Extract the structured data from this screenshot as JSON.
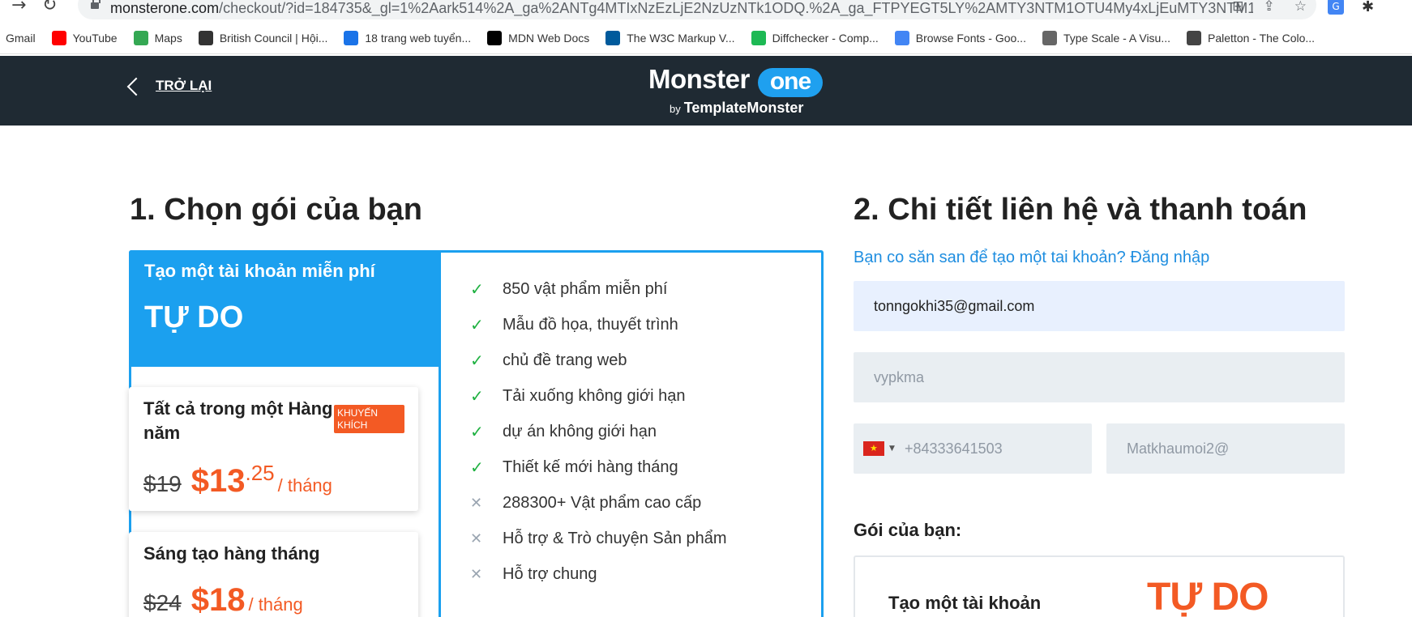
{
  "browser": {
    "url_host": "monsterone.com",
    "url_rest": "/checkout/?id=184735&_gl=1%2Aark514%2A_ga%2ANTg4MTIxNzEzLjE2NzUzNTk1ODQ.%2A_ga_FTPYEGT5LY%2AMTY3NTM1OTU4My4xLjEuMTY3NTM1OTcx...",
    "bookmarks": [
      {
        "label": "Gmail",
        "icon": "gmail-icon",
        "color": "#ffffff"
      },
      {
        "label": "YouTube",
        "icon": "youtube-icon",
        "color": "#ff0000"
      },
      {
        "label": "Maps",
        "icon": "maps-icon",
        "color": "#34a853"
      },
      {
        "label": "British Council | Hội...",
        "icon": "british-council-icon",
        "color": "#333333"
      },
      {
        "label": "18 trang web tuyển...",
        "icon": "web-icon",
        "color": "#1a73e8"
      },
      {
        "label": "MDN Web Docs",
        "icon": "mdn-icon",
        "color": "#000000"
      },
      {
        "label": "The W3C Markup V...",
        "icon": "w3c-icon",
        "color": "#005a9c"
      },
      {
        "label": "Diffchecker - Comp...",
        "icon": "diffchecker-icon",
        "color": "#1db954"
      },
      {
        "label": "Browse Fonts - Goo...",
        "icon": "google-fonts-icon",
        "color": "#4285f4"
      },
      {
        "label": "Type Scale - A Visu...",
        "icon": "type-scale-icon",
        "color": "#666666"
      },
      {
        "label": "Paletton - The Colo...",
        "icon": "paletton-icon",
        "color": "#444444"
      }
    ]
  },
  "header": {
    "back_label": "TRỞ LẠI",
    "logo_monster": "Monster",
    "logo_one": "one",
    "logo_by": "by",
    "logo_template": "TemplateMonster"
  },
  "plans": {
    "heading": "1. Chọn gói của bạn",
    "free": {
      "subtitle": "Tạo một tài khoản miễn phí",
      "name": "TỰ DO"
    },
    "cards": [
      {
        "title": "Tất cả trong một Hàng năm",
        "badge": "KHUYẾN KHÍCH",
        "old_price": "$19",
        "price": "$13",
        "cents": ".25",
        "per": "/ tháng"
      },
      {
        "title": "Sáng tạo hàng tháng",
        "old_price": "$24",
        "price": "$18",
        "per": "/ tháng"
      }
    ],
    "features": [
      {
        "text": "850 vật phẩm miễn phí",
        "included": true
      },
      {
        "text": "Mẫu đồ họa, thuyết trình",
        "included": true
      },
      {
        "text": "chủ đề trang web",
        "included": true
      },
      {
        "text": "Tải xuống không giới hạn",
        "included": true
      },
      {
        "text": "dự án không giới hạn",
        "included": true
      },
      {
        "text": "Thiết kế mới hàng tháng",
        "included": true
      },
      {
        "text": "288300+ Vật phẩm cao cấp",
        "included": false
      },
      {
        "text": "Hỗ trợ & Trò chuyện Sản phẩm",
        "included": false
      },
      {
        "text": "Hỗ trợ chung",
        "included": false
      }
    ]
  },
  "contact": {
    "heading": "2. Chi tiết liên hệ và thanh toán",
    "login_prompt": "Bạn co săn san để tạo một tai khoản? Đăng nhập",
    "email": "tonngokhi35@gmail.com",
    "name": "vypkma",
    "phone": "+84333641503",
    "password": "Matkhaumoi2@",
    "your_plan_label": "Gói của bạn:",
    "summary_left": "Tạo một tài khoản",
    "summary_right": "TỰ DO"
  },
  "colors": {
    "accent_blue": "#1ba0ef",
    "accent_orange": "#f35a24",
    "header_dark": "#1f2a33",
    "check_green": "#1fb141"
  }
}
